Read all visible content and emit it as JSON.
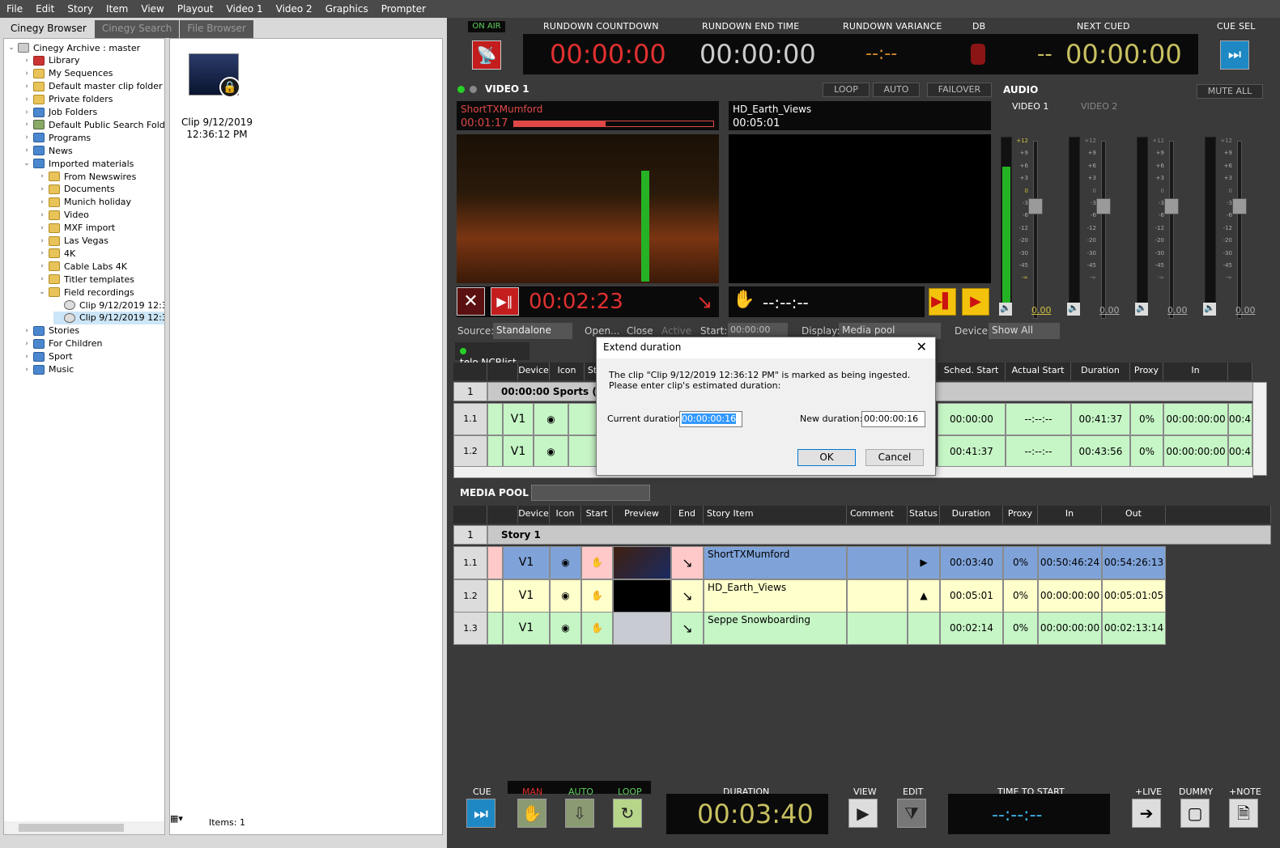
{
  "menu": [
    "File",
    "Edit",
    "Story",
    "Item",
    "View",
    "Playout",
    "Video 1",
    "Video 2",
    "Graphics",
    "Prompter"
  ],
  "browser": {
    "tabs": [
      "Cinegy Browser",
      "Cinegy Search",
      "File Browser"
    ],
    "tree": [
      {
        "label": "Cinegy Archive : master",
        "icon": "database-icon"
      },
      {
        "label": "Library",
        "icon": "library-icon"
      },
      {
        "label": "My Sequences",
        "icon": "folder-icon"
      },
      {
        "label": "Default master clip folder",
        "icon": "folder-icon"
      },
      {
        "label": "Private folders",
        "icon": "folder-icon"
      },
      {
        "label": "Job Folders",
        "icon": "book-icon"
      },
      {
        "label": "Default Public Search Folder",
        "icon": "search-folder-icon"
      },
      {
        "label": "Programs",
        "icon": "book-icon"
      },
      {
        "label": "News",
        "icon": "book-icon"
      },
      {
        "label": "Imported materials",
        "icon": "book-icon"
      },
      {
        "label": "From Newswires",
        "icon": "folder-icon"
      },
      {
        "label": "Documents",
        "icon": "folder-icon"
      },
      {
        "label": "Munich holiday",
        "icon": "folder-icon"
      },
      {
        "label": "Video",
        "icon": "folder-icon"
      },
      {
        "label": "MXF import",
        "icon": "folder-icon"
      },
      {
        "label": "Las Vegas",
        "icon": "folder-icon"
      },
      {
        "label": "4K",
        "icon": "folder-icon"
      },
      {
        "label": "Cable Labs 4K",
        "icon": "folder-icon"
      },
      {
        "label": "Titler templates",
        "icon": "folder-icon"
      },
      {
        "label": "Field recordings",
        "icon": "folder-icon"
      },
      {
        "label": "Clip 9/12/2019 12:3(",
        "icon": "clip-icon"
      },
      {
        "label": "Clip 9/12/2019 12:3(",
        "icon": "clip-icon"
      },
      {
        "label": "Stories",
        "icon": "book-icon"
      },
      {
        "label": "For Children",
        "icon": "book-icon"
      },
      {
        "label": "Sport",
        "icon": "book-icon"
      },
      {
        "label": "Music",
        "icon": "book-icon"
      }
    ],
    "content_item": {
      "title_line1": "Clip 9/12/2019",
      "title_line2": "12:36:12 PM"
    },
    "items_count": "Items: 1"
  },
  "topbar": {
    "on_air": "ON AIR",
    "rundown_countdown_label": "RUNDOWN COUNTDOWN",
    "rundown_countdown": "00:00:00",
    "rundown_end_label": "RUNDOWN END TIME",
    "rundown_end": "00:00:00",
    "variance_label": "RUNDOWN VARIANCE",
    "variance": "--:--",
    "db_label": "DB",
    "next_cued_label": "NEXT CUED",
    "next_cued_prefix": "--",
    "next_cued": "00:00:00",
    "cue_sel_label": "CUE SEL"
  },
  "video": {
    "title": "VIDEO 1",
    "loop": "LOOP",
    "auto": "AUTO",
    "failover": "FAILOVER",
    "left_clip": "ShortTXMumford",
    "left_time": "00:01:17",
    "left_progress": 0.46,
    "right_clip": "HD_Earth_Views",
    "right_time": "00:05:01",
    "remaining": "00:02:23",
    "right_remaining": "--:--:--"
  },
  "audio": {
    "title": "AUDIO",
    "mute_all": "MUTE ALL",
    "ch1": "VIDEO 1",
    "ch2": "VIDEO 2",
    "scale": [
      "+12",
      "+9",
      "+6",
      "+3",
      "0",
      "-3",
      "-6",
      "-12",
      "-20",
      "-30",
      "-45",
      "-∞"
    ],
    "fader_values": [
      "0.00",
      "0.00",
      "0.00",
      "0.00"
    ]
  },
  "source_bar": {
    "source_label": "Source:",
    "source": "Standalone",
    "open": "Open...",
    "close": "Close",
    "active": "Active",
    "start_label": "Start:",
    "start": "00:00:00",
    "display_label": "Display:",
    "display": "Media pool",
    "device_label": "Device:",
    "device": "Show All"
  },
  "rundown": {
    "tab": "telo.NCRlist",
    "headers": [
      "Device",
      "Icon",
      "St",
      "Sched. Start",
      "Actual Start",
      "Duration",
      "Proxy",
      "In"
    ],
    "group": {
      "num": "1",
      "label": "00:00:00  Sports (01"
    },
    "rows": [
      {
        "num": "1.1",
        "device": "V1",
        "sched": "00:00:00",
        "actual": "--:--:--",
        "dur": "00:41:37",
        "proxy": "0%",
        "in": "00:00:00:00",
        "out": "00:4"
      },
      {
        "num": "1.2",
        "device": "V1",
        "sched": "00:41:37",
        "actual": "--:--:--",
        "dur": "00:43:56",
        "proxy": "0%",
        "in": "00:00:00:00",
        "out": "00:4"
      }
    ]
  },
  "dialog": {
    "title": "Extend duration",
    "message": "The clip \"Clip 9/12/2019 12:36:12 PM\" is marked as being ingested. Please enter clip's estimated duration:",
    "current_label": "Current duration:",
    "current": "00:00:00:16",
    "new_label": "New duration:",
    "new": "00:00:00:16",
    "ok": "OK",
    "cancel": "Cancel"
  },
  "media_pool": {
    "title": "MEDIA POOL",
    "headers": [
      "Device",
      "Icon",
      "Start",
      "Preview",
      "End",
      "Story Item",
      "Comment",
      "Status",
      "Duration",
      "Proxy",
      "In",
      "Out"
    ],
    "group": {
      "num": "1",
      "label": "Story 1"
    },
    "rows": [
      {
        "num": "1.1",
        "device": "V1",
        "item": "ShortTXMumford",
        "status": "▶",
        "dur": "00:03:40",
        "proxy": "0%",
        "in": "00:50:46:24",
        "out": "00:54:26:13",
        "color": "blu"
      },
      {
        "num": "1.2",
        "device": "V1",
        "item": "HD_Earth_Views",
        "status": "▲",
        "dur": "00:05:01",
        "proxy": "0%",
        "in": "00:00:00:00",
        "out": "00:05:01:05",
        "color": "ylw"
      },
      {
        "num": "1.3",
        "device": "V1",
        "item": "Seppe Snowboarding",
        "status": "",
        "dur": "00:02:14",
        "proxy": "0%",
        "in": "00:00:00:00",
        "out": "00:02:13:14",
        "color": "grn"
      }
    ]
  },
  "bottom": {
    "cue": "CUE",
    "man": "MAN",
    "auto": "AUTO",
    "loop": "LOOP",
    "duration_label": "DURATION",
    "duration": "00:03:40",
    "view": "VIEW",
    "edit": "EDIT",
    "time_to_start_label": "TIME TO START",
    "time_to_start": "--:--:--",
    "live": "+LIVE",
    "dummy": "DUMMY",
    "note": "+NOTE"
  },
  "colors": {
    "accent_blue": "#1e88c4",
    "onair_red": "#c31d1d",
    "timer_red": "#e03030",
    "timer_yellow": "#c8c060",
    "clock_white": "#cccccc",
    "meter_green": "#25b325"
  }
}
